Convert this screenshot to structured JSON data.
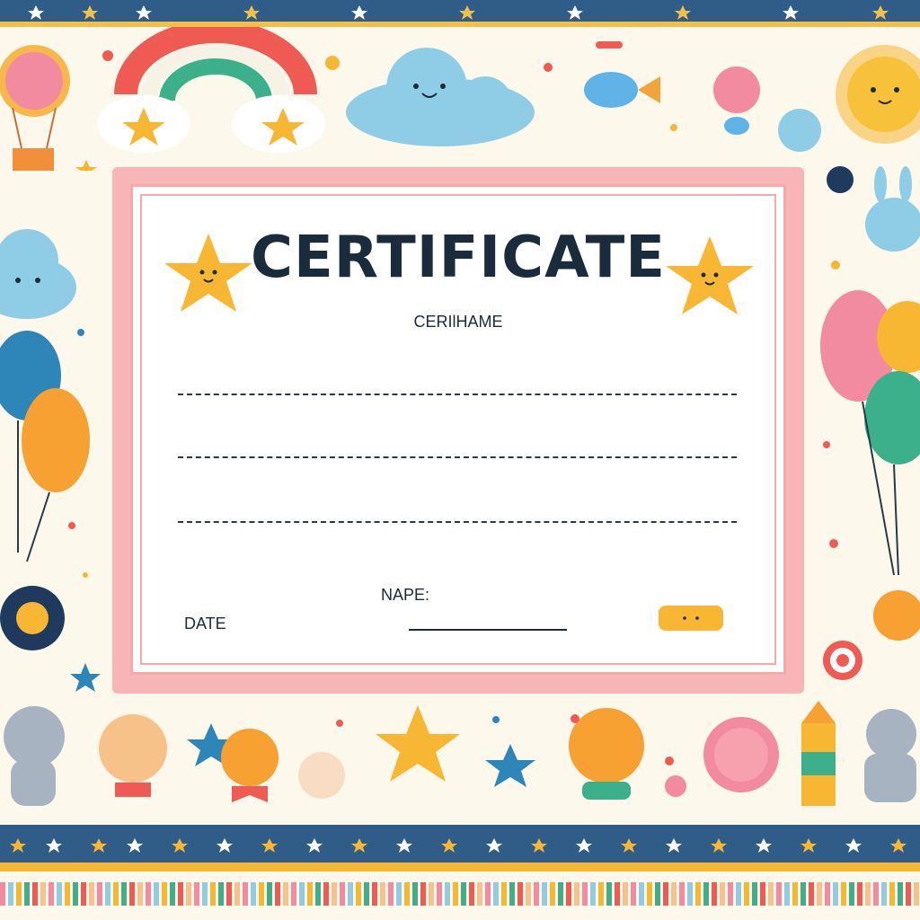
{
  "certificate": {
    "title": "CERTIFICATE",
    "subtitle": "CERIlHAME",
    "name_label": "NAPE:",
    "date_label": "DATE"
  },
  "colors": {
    "frame_pink": "#f8b5b7",
    "band_blue": "#2f5d87",
    "band_yellow": "#f7b733",
    "background": "#fdf8ec",
    "text_dark": "#1a2b3c"
  }
}
